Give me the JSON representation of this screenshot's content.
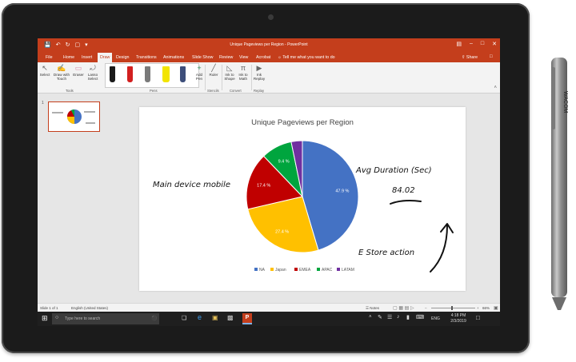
{
  "app": {
    "window_title": "Unique Pageviews per Region - PowerPoint",
    "tabs": [
      "File",
      "Home",
      "Insert",
      "Draw",
      "Design",
      "Transitions",
      "Animations",
      "Slide Show",
      "Review",
      "View",
      "Acrobat"
    ],
    "active_tab": "Draw",
    "tell_me": "Tell me what you want to do",
    "share": "Share"
  },
  "ribbon": {
    "tools": [
      {
        "l1": "Select",
        "l2": ""
      },
      {
        "l1": "Draw with",
        "l2": "Touch"
      },
      {
        "l1": "Eraser",
        "l2": ""
      },
      {
        "l1": "Lasso",
        "l2": "Select"
      }
    ],
    "tools_group": "Tools",
    "pens_group": "Pens",
    "add_pen": {
      "l1": "Add",
      "l2": "Pen"
    },
    "ruler": "Ruler",
    "stencils_group": "Stencils",
    "convert": [
      {
        "l1": "Ink to",
        "l2": "Shape"
      },
      {
        "l1": "Ink to",
        "l2": "Math"
      }
    ],
    "convert_group": "Convert",
    "replay": {
      "l1": "Ink",
      "l2": "Replay"
    },
    "replay_group": "Replay",
    "pen_colors": [
      "#1a1a1a",
      "#d21f1f",
      "#7a7a7a",
      "#f2e400",
      "#3d4e7a"
    ]
  },
  "thumbnail": {
    "number": "1"
  },
  "slide": {
    "annotations": {
      "left": "Main device mobile",
      "avg_label": "Avg Duration (Sec)",
      "avg_value": "84.02",
      "store": "E Store action"
    },
    "ink_color": "#111111"
  },
  "chart_data": {
    "type": "pie",
    "title": "Unique Pageviews per Region",
    "categories": [
      "NA",
      "Japan",
      "EMEA",
      "APAC",
      "LATAM"
    ],
    "values": [
      47.9,
      27.4,
      17.4,
      9.4,
      3.4
    ],
    "labels": [
      "47.9 %",
      "27.4 %",
      "17.4 %",
      "9.4 %",
      ""
    ],
    "colors": [
      "#4472c4",
      "#ffc000",
      "#c00000",
      "#00a53e",
      "#7030a0"
    ],
    "legend_position": "bottom"
  },
  "status": {
    "slide": "Slide 1 of 1",
    "language": "English (United States)",
    "notes": "Notes",
    "zoom": "66%"
  },
  "taskbar": {
    "search_placeholder": "Type here to search",
    "lang": "ENG",
    "time": "4:18 PM",
    "date": "2/3/2019"
  },
  "pen_brand": "WACOM"
}
